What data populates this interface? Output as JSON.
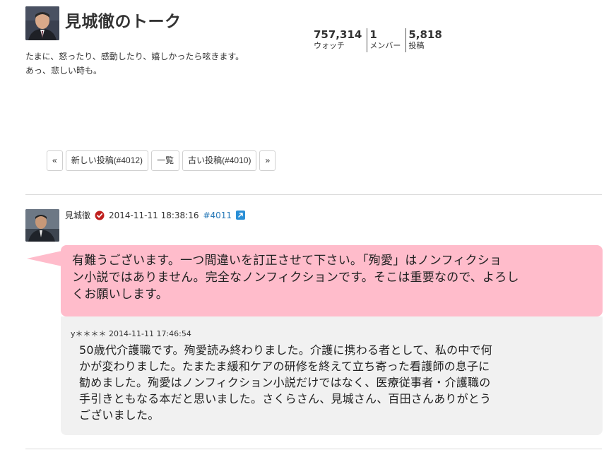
{
  "channel": {
    "title": "見城徹のトーク",
    "description_line1": "たまに、怒ったり、感動したり、嬉しかったら呟きます。",
    "description_line2": "あっ、悲しい時も。"
  },
  "stats": [
    {
      "value": "757,314",
      "label": "ウォッチ"
    },
    {
      "value": "1",
      "label": "メンバー"
    },
    {
      "value": "5,818",
      "label": "投稿"
    }
  ],
  "pager": {
    "first": "«",
    "newer": "新しい投稿(#4012)",
    "list": "一覧",
    "older": "古い投稿(#4010)",
    "last": "»"
  },
  "post": {
    "author": "見城徹",
    "timestamp": "2014-11-11 18:38:16",
    "number": "#4011",
    "message_line1": "有難うございます。一つ間違いを訂正させて下さい。「殉愛」はノンフィクショ",
    "message_line2": "ン小説ではありません。完全なノンフィクションです。そこは重要なので、よろし",
    "message_line3": "くお願いします。",
    "bubble_color": "#ffbccb"
  },
  "reply": {
    "author": "y＊＊＊＊",
    "timestamp": "2014-11-11 17:46:54",
    "line1": "50歳代介護職です。殉愛読み終わりました。介護に携わる者として、私の中で何",
    "line2": "かが変わりました。たまたま緩和ケアの研修を終えて立ち寄った看護師の息子に",
    "line3": "勧めました。殉愛はノンフィクション小説だけではなく、医療従事者・介護職の",
    "line4": "手引きともなる本だと思いました。さくらさん、見城さん、百田さんありがとう",
    "line5": "ございました。"
  },
  "icons": {
    "verified": "verified-badge-icon",
    "permalink": "external-link-icon"
  }
}
